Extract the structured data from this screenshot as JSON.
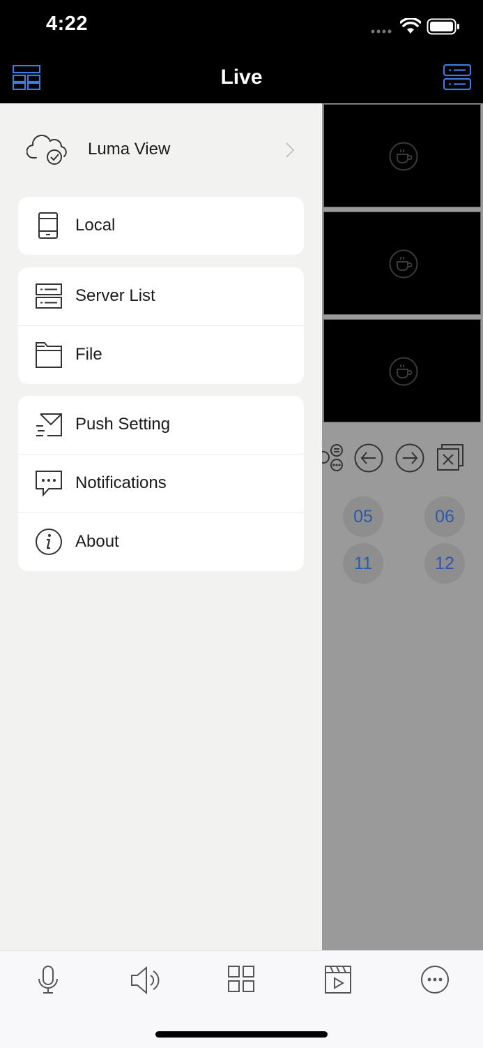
{
  "status_bar": {
    "time": "4:22"
  },
  "nav": {
    "title": "Live"
  },
  "drawer": {
    "cloud": {
      "label": "Luma View"
    },
    "groups": [
      [
        {
          "label": "Local",
          "icon": "tablet-icon"
        }
      ],
      [
        {
          "label": "Server List",
          "icon": "server-list-icon"
        },
        {
          "label": "File",
          "icon": "folder-icon"
        }
      ],
      [
        {
          "label": "Push Setting",
          "icon": "push-mail-icon"
        },
        {
          "label": "Notifications",
          "icon": "chat-bubble-icon"
        },
        {
          "label": "About",
          "icon": "info-icon"
        }
      ]
    ]
  },
  "live": {
    "channels": [
      "05",
      "06",
      "11",
      "12"
    ]
  },
  "tab_bar": {
    "icons": [
      "microphone-icon",
      "speaker-icon",
      "grid-icon",
      "playback-icon",
      "more-icon"
    ]
  },
  "colors": {
    "accent": "#2f6fd6",
    "channel_text": "#2d5aa8"
  }
}
